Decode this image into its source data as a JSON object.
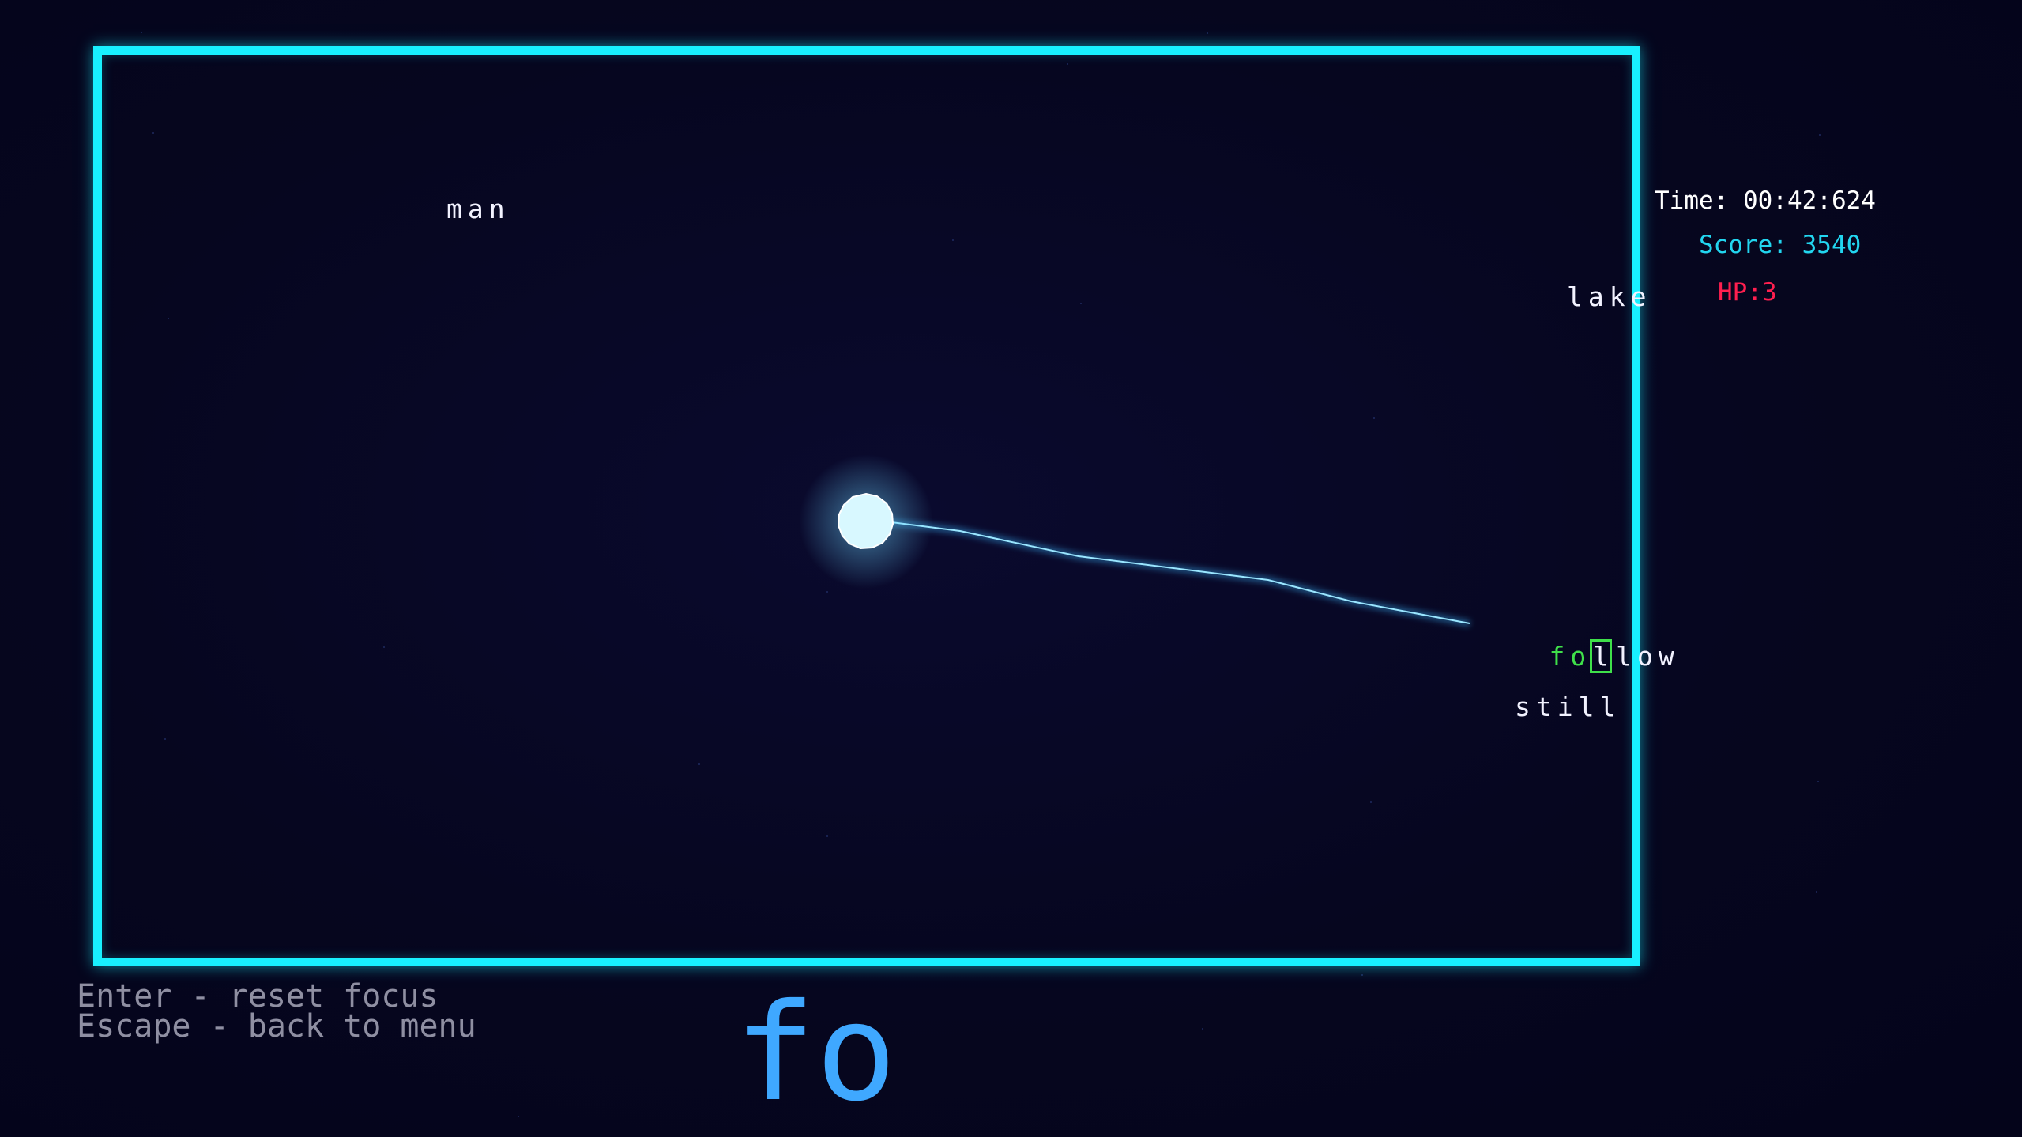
{
  "hud": {
    "time_label": "Time: 00:42:624",
    "score_label": "Score: 3540",
    "hp_label": "HP:3"
  },
  "words": {
    "man": "man",
    "lake": "lake",
    "still": "still",
    "follow": {
      "typed": "fo",
      "current": "l",
      "rest": "low"
    }
  },
  "help": {
    "enter": "Enter - reset focus",
    "escape": "Escape - back to menu"
  },
  "input": {
    "value": "fo"
  },
  "colors": {
    "arena_border": "#18f0ff",
    "typed_letters": "#3fe04a",
    "score": "#22d6f0",
    "hp": "#ff1f4f",
    "input": "#3fa8ff",
    "player": "#d8f8ff"
  },
  "icons": {
    "player": "player-orb-icon"
  }
}
